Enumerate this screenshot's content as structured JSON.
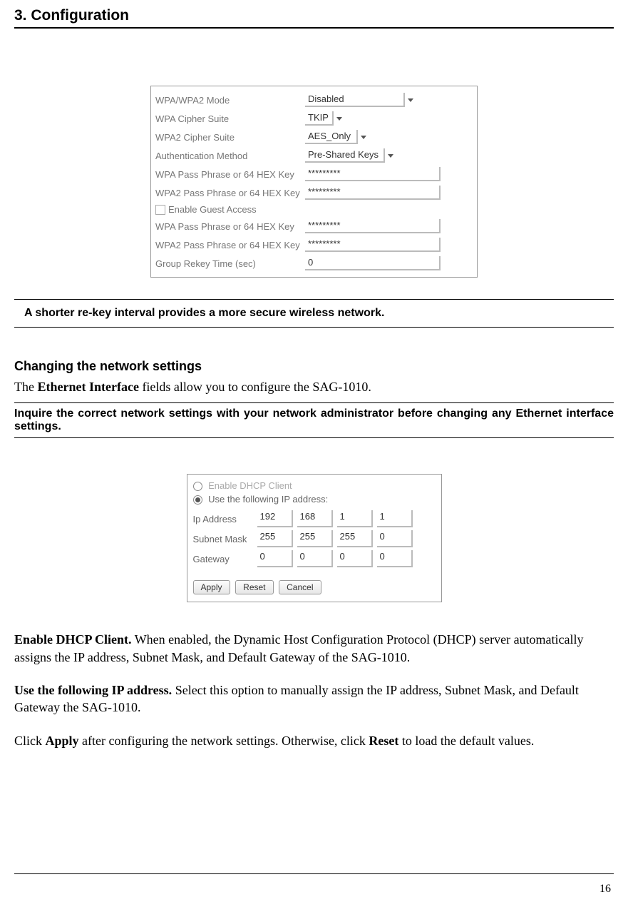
{
  "header": {
    "title": "3. Configuration"
  },
  "wpa_panel": {
    "rows": [
      {
        "label": "WPA/WPA2 Mode",
        "value": "Disabled",
        "w": 140,
        "dd": true
      },
      {
        "label": "WPA Cipher Suite",
        "value": "TKIP",
        "w": 56,
        "dd": true
      },
      {
        "label": "WPA2 Cipher Suite",
        "value": "AES_Only",
        "w": 90,
        "dd": true
      },
      {
        "label": "Authentication Method",
        "value": "Pre-Shared Keys",
        "w": 128,
        "dd": true
      },
      {
        "label": "WPA Pass Phrase or 64 HEX Key",
        "value": "*********",
        "w": 190
      },
      {
        "label": "WPA2 Pass Phrase or 64 HEX Key",
        "value": "*********",
        "w": 190
      },
      {
        "check": true,
        "label": "Enable Guest Access"
      },
      {
        "label": "WPA Pass Phrase or 64 HEX Key",
        "value": "*********",
        "w": 190
      },
      {
        "label": "WPA2 Pass Phrase or 64 HEX Key",
        "value": "*********",
        "w": 190
      },
      {
        "label": "Group Rekey Time (sec)",
        "value": "0",
        "w": 190
      }
    ]
  },
  "note1": "A shorter re-key interval provides a more secure wireless network.",
  "section": {
    "heading": "Changing the network settings",
    "intro_pre": "The ",
    "intro_bold": "Ethernet Interface",
    "intro_post": " fields allow you to configure the SAG-1010."
  },
  "warn": "Inquire the correct network settings with your network administrator before changing any Ethernet interface settings.",
  "ip_panel": {
    "opt_dhcp": "Enable DHCP Client",
    "opt_static": "Use the following IP address:",
    "rows": [
      {
        "label": "Ip Address",
        "v": [
          "192",
          "168",
          "1",
          "1"
        ]
      },
      {
        "label": "Subnet Mask",
        "v": [
          "255",
          "255",
          "255",
          "0"
        ]
      },
      {
        "label": "Gateway",
        "v": [
          "0",
          "0",
          "0",
          "0"
        ]
      }
    ],
    "buttons": {
      "apply": "Apply",
      "reset": "Reset",
      "cancel": "Cancel"
    }
  },
  "para1_b": "Enable DHCP Client.",
  "para1": " When enabled, the Dynamic Host Configuration Protocol (DHCP) server automatically assigns the IP address, Subnet Mask, and Default Gateway of the SAG-1010.",
  "para2_b": "Use the following IP address.",
  "para2": " Select this option to manually assign the IP address, Subnet Mask, and Default Gateway the SAG-1010.",
  "para3_a": "Click ",
  "para3_b1": "Apply",
  "para3_m": " after configuring the network settings. Otherwise, click ",
  "para3_b2": "Reset",
  "para3_e": " to load the default values.",
  "page_number": "16"
}
